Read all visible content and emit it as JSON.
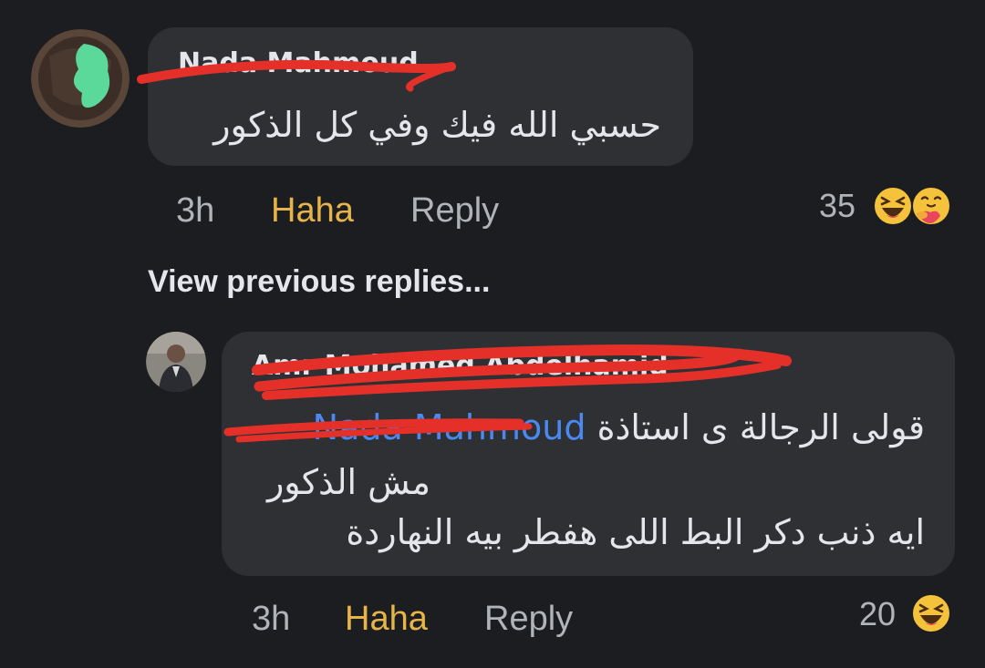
{
  "comments": [
    {
      "author": "Nada Mahmoud",
      "text": "حسبي الله فيك وفي كل الذكور",
      "time": "3h",
      "reaction_label": "Haha",
      "reply_label": "Reply",
      "reaction_count": "35",
      "reaction_icons": [
        "haha-emoji-icon",
        "care-emoji-icon"
      ]
    }
  ],
  "view_previous_label": "View previous replies...",
  "reply": {
    "author": "Amr Mohamed Abdelhamid",
    "mention": "Nada Mahmoud",
    "line1_text": "قولى الرجالة ى استاذة",
    "line2": "مش الذكور",
    "line3": "ايه ذنب دكر البط اللى هفطر بيه النهاردة",
    "time": "3h",
    "reaction_label": "Haha",
    "reply_label": "Reply",
    "reaction_count": "20",
    "reaction_icons": [
      "haha-emoji-icon"
    ]
  },
  "colors": {
    "background": "#1c1d20",
    "bubble": "#2f3033",
    "text": "#e4e6eb",
    "muted": "#b0b3b8",
    "haha_active": "#e7b449",
    "mention": "#4a8af0",
    "redaction": "#e5302a"
  }
}
